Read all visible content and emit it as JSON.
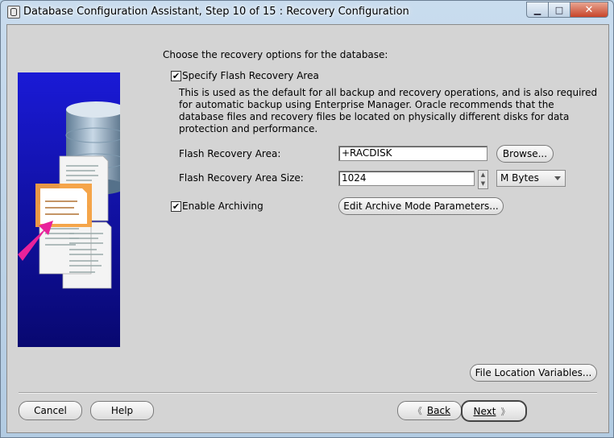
{
  "window": {
    "title": "Database Configuration Assistant, Step 10 of 15 : Recovery Configuration",
    "minimize_glyph": "▁",
    "maximize_glyph": "□",
    "close_glyph": "✕"
  },
  "main": {
    "heading": "Choose the recovery options for the database:",
    "specify_fra": {
      "checked": true,
      "check_glyph": "✔",
      "label": "Specify Flash Recovery Area",
      "description": "This is used as the default for all backup and recovery operations, and is also required for automatic backup using Enterprise Manager. Oracle recommends that the database files and recovery files be located on physically different disks for data protection and performance."
    },
    "fra_location": {
      "label": "Flash Recovery Area:",
      "value": "+RACDISK",
      "browse_label": "Browse..."
    },
    "fra_size": {
      "label": "Flash Recovery Area Size:",
      "value": "1024",
      "unit_selected": "M Bytes",
      "spinner_up": "▲",
      "spinner_down": "▼"
    },
    "archiving": {
      "checked": true,
      "check_glyph": "✔",
      "label": "Enable Archiving",
      "edit_params_label": "Edit Archive Mode Parameters..."
    },
    "file_location_variables_label": "File Location Variables..."
  },
  "footer": {
    "cancel_label": "Cancel",
    "help_label": "Help",
    "back_label": "Back",
    "next_label": "Next",
    "back_arrow": "《",
    "next_arrow": "》"
  },
  "colors": {
    "panel_bg": "#d4d4d4",
    "illustration_blue": "#1a1ad6",
    "arrow_magenta": "#e8229a",
    "highlight_orange": "#f4a040"
  },
  "icons": {
    "app": "dbca-window-icon",
    "illustration": "database-documents-illustration"
  }
}
